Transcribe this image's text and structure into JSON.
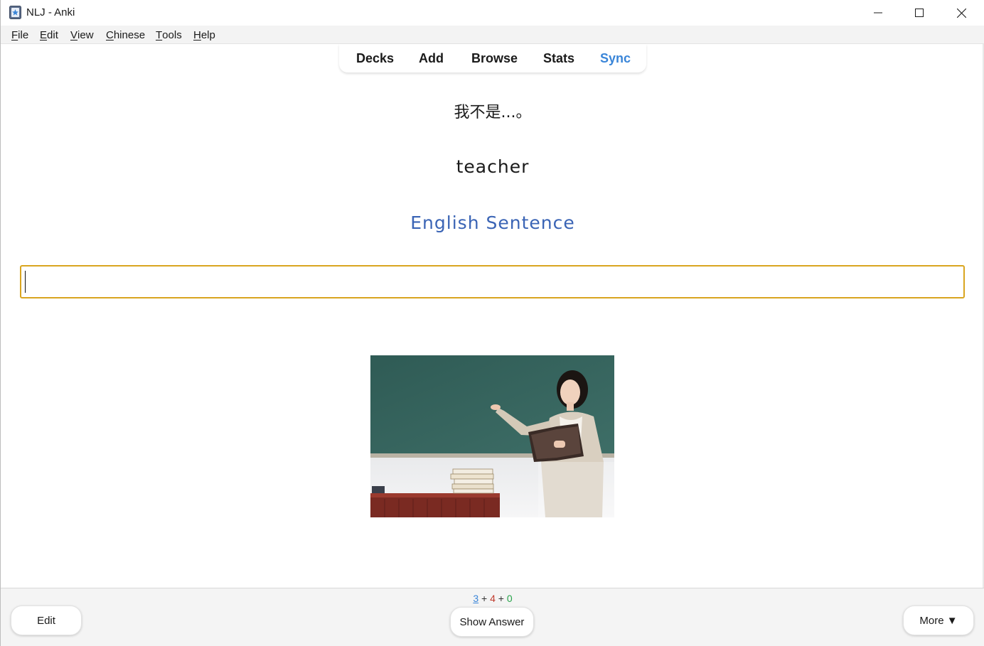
{
  "window": {
    "title": "NLJ - Anki",
    "controls": [
      "minimize-icon",
      "maximize-icon",
      "close-icon"
    ]
  },
  "menubar": {
    "items": [
      {
        "first": "F",
        "rest": "ile"
      },
      {
        "first": "E",
        "rest": "dit"
      },
      {
        "first": "V",
        "rest": "iew"
      },
      {
        "first": "C",
        "rest": "hinese"
      },
      {
        "first": "T",
        "rest": "ools"
      },
      {
        "first": "H",
        "rest": "elp"
      }
    ]
  },
  "toolbar": {
    "decks": "Decks",
    "add": "Add",
    "browse": "Browse",
    "stats": "Stats",
    "sync": "Sync"
  },
  "card": {
    "chinese_sentence": "我不是...。",
    "word": "teacher",
    "english_sentence": "English Sentence",
    "answer_value": "",
    "image": "teacher-at-chalkboard"
  },
  "counts": {
    "new": "3",
    "sep1": " + ",
    "learn": "4",
    "sep2": " + ",
    "review": "0"
  },
  "bottom": {
    "edit": "Edit",
    "show_answer": "Show Answer",
    "more": "More ▼"
  },
  "colors": {
    "sync": "#3a85d8",
    "english_sentence": "#3a64b5",
    "input_border": "#d9a520",
    "count_new": "#3a85d8",
    "count_learn": "#c0392b",
    "count_review": "#27a34a"
  }
}
